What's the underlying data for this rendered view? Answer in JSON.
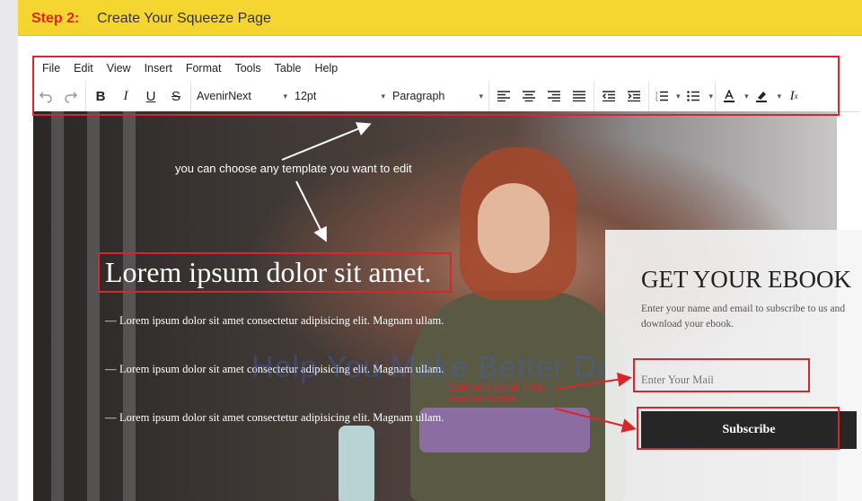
{
  "header": {
    "step_number": "Step 2:",
    "step_title": "Create Your Squeeze Page"
  },
  "menu": {
    "items": [
      "File",
      "Edit",
      "View",
      "Insert",
      "Format",
      "Tools",
      "Table",
      "Help"
    ]
  },
  "toolbar": {
    "font_family": "AvenirNext",
    "font_size": "12pt",
    "block_format": "Paragraph",
    "icons": [
      "undo-icon",
      "redo-icon",
      "bold-icon",
      "italic-icon",
      "underline-icon",
      "strikethrough-icon",
      "align-left-icon",
      "align-center-icon",
      "align-right-icon",
      "align-justify-icon",
      "outdent-icon",
      "indent-icon",
      "numbered-list-icon",
      "bullet-list-icon",
      "text-color-icon",
      "highlight-icon",
      "clear-formatting-icon"
    ]
  },
  "page": {
    "heading": "Lorem ipsum dolor sit amet.",
    "bullets": [
      "Lorem ipsum dolor sit amet consectetur adipisicing elit. Magnam ullam.",
      "Lorem ipsum dolor sit amet consectetur adipisicing elit. Magnam ullam.",
      "Lorem ipsum dolor sit amet consectetur adipisicing elit. Magnam ullam."
    ],
    "form": {
      "title": "GET YOUR EBOOK",
      "description": "Enter your name and email to subscribe to us and download your ebook.",
      "email_placeholder": "Enter Your Mail",
      "button_label": "Subscribe"
    },
    "watermark": "Help You Make Better Decisions"
  },
  "annotations": {
    "template_note": "you can choose any template you want to edit",
    "email_note_line1": "add your email here",
    "email_note_line2": "and subscribe"
  },
  "colors": {
    "header_bg": "#f5d631",
    "step_red": "#e0231a",
    "annotation_red": "#d9262c"
  }
}
